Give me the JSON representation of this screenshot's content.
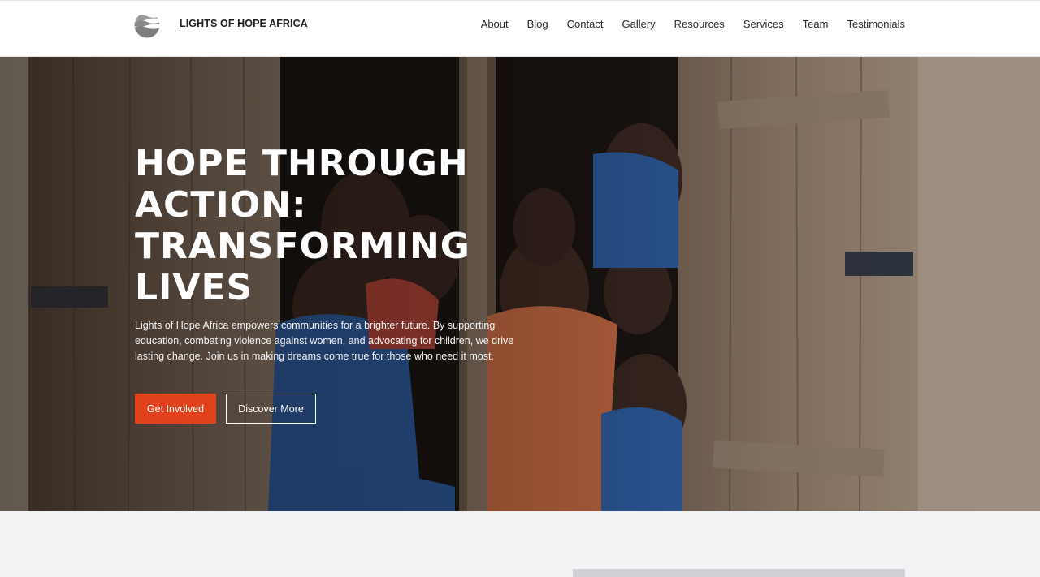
{
  "header": {
    "logo_icon": "striped-globe-logo",
    "brand": "LIGHTS OF HOPE AFRICA",
    "nav": [
      "About",
      "Blog",
      "Contact",
      "Gallery",
      "Resources",
      "Services",
      "Team",
      "Testimonials"
    ]
  },
  "hero": {
    "image": "children-smiling-in-wooden-window-photo",
    "title": "HOPE THROUGH ACTION: TRANSFORMING LIVES",
    "description": "Lights of Hope Africa empowers communities for a brighter future. By supporting education, combating violence against women, and advocating for children, we drive lasting change. Join us in making dreams come true for those who need it most.",
    "primary_button": "Get Involved",
    "secondary_button": "Discover More"
  },
  "colors": {
    "accent": "#e1421b",
    "header_bg": "#ffffff",
    "page_bg": "#f1f2f4"
  }
}
